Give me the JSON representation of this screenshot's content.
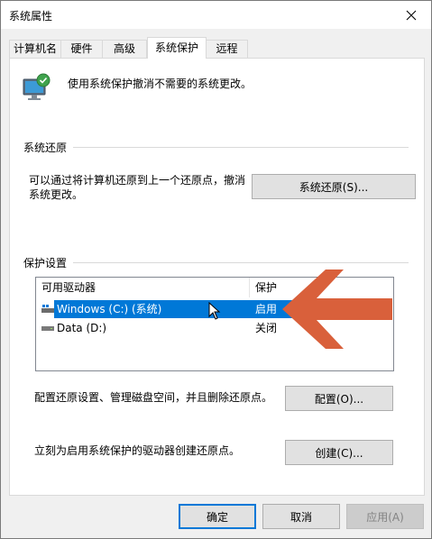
{
  "window": {
    "title": "系统属性",
    "close_icon": "close-icon"
  },
  "tabs": [
    {
      "label": "计算机名"
    },
    {
      "label": "硬件"
    },
    {
      "label": "高级"
    },
    {
      "label": "系统保护"
    },
    {
      "label": "远程"
    }
  ],
  "intro": {
    "text": "使用系统保护撤消不需要的系统更改。"
  },
  "restore": {
    "heading": "系统还原",
    "description": "可以通过将计算机还原到上一个还原点，撤消系统更改。",
    "button": "系统还原(S)..."
  },
  "protection": {
    "heading": "保护设置",
    "columns": [
      "可用驱动器",
      "保护"
    ],
    "drives": [
      {
        "name": "Windows (C:) (系统)",
        "status": "启用"
      },
      {
        "name": "Data (D:)",
        "status": "关闭"
      }
    ],
    "configure_text": "配置还原设置、管理磁盘空间，并且删除还原点。",
    "configure_button": "配置(O)...",
    "create_text": "立刻为启用系统保护的驱动器创建还原点。",
    "create_button": "创建(C)..."
  },
  "footer": {
    "ok": "确定",
    "cancel": "取消",
    "apply": "应用(A)"
  },
  "colors": {
    "arrow": "#d9603b",
    "selection": "#0078d7"
  }
}
